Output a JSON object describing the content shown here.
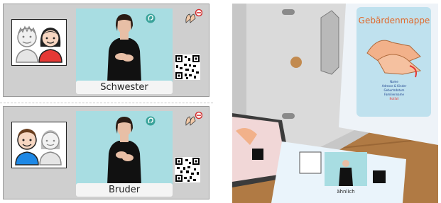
{
  "cards": [
    {
      "caption": "Schwester",
      "symbol": "two-people-sister-highlighted-icon",
      "video": "sign-language-interpreter-video"
    },
    {
      "caption": "Bruder",
      "symbol": "two-people-brother-highlighted-icon",
      "video": "sign-language-interpreter-video"
    }
  ],
  "photo": {
    "folder_title": "Gebärdenmappe",
    "folder_lines": [
      "Name",
      "Adresse & Kinder",
      "Geburtsdatum",
      "Familienname",
      "Notfall"
    ],
    "small_card_caption": "ähnlich"
  },
  "colors": {
    "card_bg": "#cfcfcf",
    "video_bg": "#a8dde2",
    "hair_red": "#e53935",
    "shirt_blue": "#1e88e5",
    "photo_wood": "#b07a44"
  }
}
